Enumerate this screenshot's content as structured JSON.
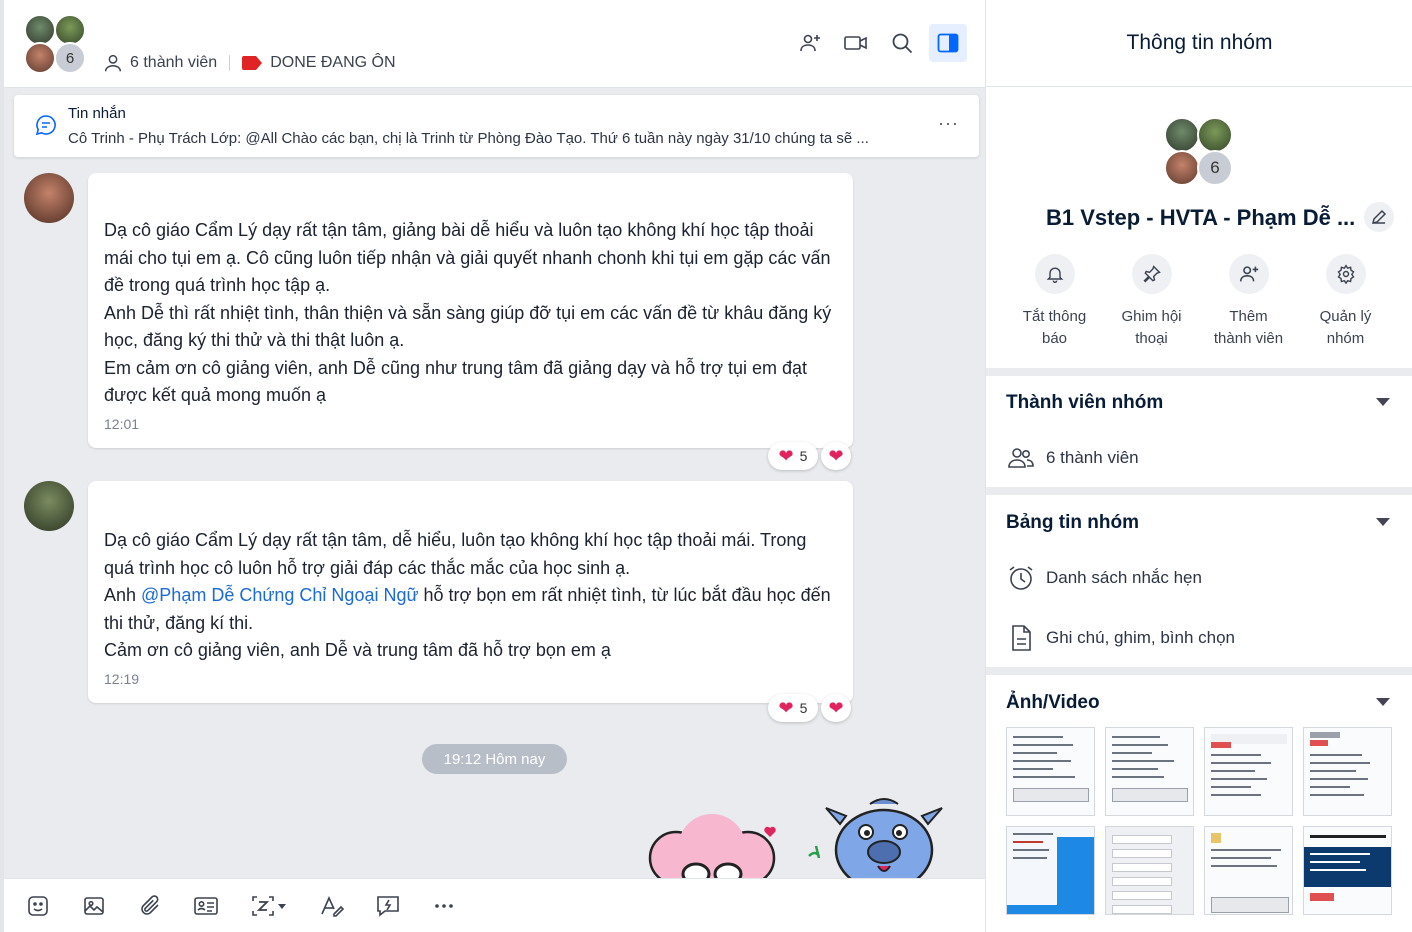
{
  "header": {
    "avatar_count": "6",
    "member_count_label": "6 thành viên",
    "tag_label": "DONE ĐANG ÔN",
    "tag_color": "#e02424",
    "actions": [
      "add-member-icon",
      "video-call-icon",
      "search-icon",
      "toggle-info-panel-icon"
    ]
  },
  "pinned": {
    "title": "Tin nhắn",
    "text": "Cô Trinh - Phụ Trách Lớp: @All Chào các bạn, chị là Trinh từ Phòng Đào Tạo. Thứ 6 tuần này ngày 31/10 chúng ta sẽ ...",
    "more": "···"
  },
  "messages": [
    {
      "lines": [
        "Dạ cô giáo Cẩm Lý dạy rất tận tâm, giảng bài dễ hiểu và luôn tạo không khí học tập thoải mái cho tụi em ạ. Cô cũng luôn tiếp nhận và giải quyết nhanh chonh khi tụi em gặp các vấn đề trong quá trình học tập ạ.",
        "Anh Dễ thì rất nhiệt tình, thân thiện và sẵn sàng giúp đỡ tụi em các vấn đề từ khâu đăng ký học, đăng ký thi thử và thi thật luôn ạ.",
        "Em cảm ơn cô giảng viên, anh Dễ cũng như trung tâm đã giảng dạy và hỗ trợ tụi em đạt được kết quả mong muốn ạ"
      ],
      "time": "12:01",
      "reaction_count": "5"
    },
    {
      "line1": "Dạ cô giáo Cẩm Lý dạy rất tận tâm, dễ hiểu, luôn tạo không khí học tập thoải mái. Trong quá trình học cô luôn hỗ trợ giải đáp các thắc mắc của học sinh ạ.",
      "line2_prefix": "Anh ",
      "mention": "@Phạm Dễ Chứng Chỉ Ngoại Ngữ",
      "line2_suffix": " hỗ trợ bọn em rất nhiệt tình, từ lúc bắt đầu học đến thi thử, đăng kí thi.",
      "line3": "Cảm ơn cô giảng viên, anh Dễ và trung tâm đã hỗ trợ bọn em ạ",
      "time": "12:19",
      "reaction_count": "5"
    }
  ],
  "time_divider": "19:12 Hôm nay",
  "composer": {
    "tools": [
      "sticker-icon",
      "image-icon",
      "attachment-icon",
      "contact-card-icon",
      "screenshot-icon",
      "format-text-icon",
      "quick-message-icon",
      "more-icon"
    ]
  },
  "info": {
    "title": "Thông tin nhóm",
    "avatar_count": "6",
    "group_name": "B1 Vstep - HVTA - Phạm Dễ ...",
    "quick_actions": [
      {
        "icon": "bell-icon",
        "label": "Tắt thông báo"
      },
      {
        "icon": "pin-icon",
        "label": "Ghim hội thoại"
      },
      {
        "icon": "add-member-icon",
        "label": "Thêm thành viên"
      },
      {
        "icon": "settings-icon",
        "label": "Quản lý nhóm"
      }
    ],
    "members_section": {
      "title": "Thành viên nhóm",
      "row": "6 thành viên"
    },
    "board_section": {
      "title": "Bảng tin nhóm",
      "rows": [
        "Danh sách nhắc hẹn",
        "Ghi chú, ghim, bình chọn"
      ]
    },
    "media_section": {
      "title": "Ảnh/Video"
    }
  },
  "colors": {
    "accent": "#0068ff",
    "mention": "#1a6ad8",
    "heart": "#e0245e"
  }
}
